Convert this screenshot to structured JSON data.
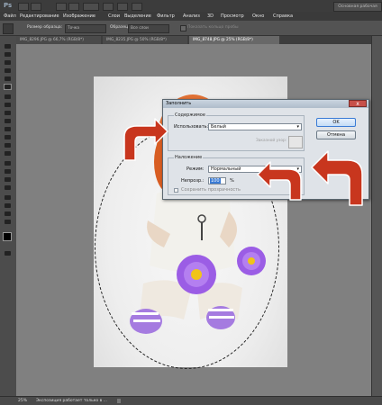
{
  "app": {
    "logo": "Ps",
    "workspace_button": "Основная рабочая"
  },
  "menu": [
    "Файл",
    "Редактирование",
    "Изображение",
    "Слои",
    "Выделение",
    "Фильтр",
    "Анализ",
    "3D",
    "Просмотр",
    "Окно",
    "Справка"
  ],
  "options": {
    "sample_size_label": "Размер образца:",
    "sample_size_value": "Точка",
    "sample_label": "Образец:",
    "sample_value": "Все слои",
    "show_ring_label": "Показать кольцо пробы"
  },
  "tabs": [
    {
      "label": "IMG_8296.JPG @ 66,7% (RGB/8*)",
      "active": false
    },
    {
      "label": "IMG_8235.JPG @ 50% (RGB/8*)",
      "active": false
    },
    {
      "label": "IMG_8748.JPG @ 25% (RGB/8*)",
      "active": true
    }
  ],
  "status": {
    "zoom": "25%",
    "message": "Экспозиция работает только в ..."
  },
  "dialog": {
    "title": "Заполнить",
    "content_group": "Содержимое",
    "use_label": "Использовать:",
    "use_value": "Белый",
    "custom_pattern_label": "Заказной узор:",
    "blending_group": "Наложение",
    "mode_label": "Режим:",
    "mode_value": "Нормальный",
    "opacity_label": "Непрозр.:",
    "opacity_value": "100",
    "opacity_unit": "%",
    "preserve_transparency_label": "Сохранить прозрачность",
    "ok_label": "OK",
    "cancel_label": "Отмена",
    "close_glyph": "x"
  },
  "colors": {
    "arrow_fill": "#c8361e",
    "arrow_stroke": "#ffffff",
    "dialog_bg": "#dfe3e8",
    "ok_border": "#3a7bd5",
    "flower": "#9b5de5"
  }
}
